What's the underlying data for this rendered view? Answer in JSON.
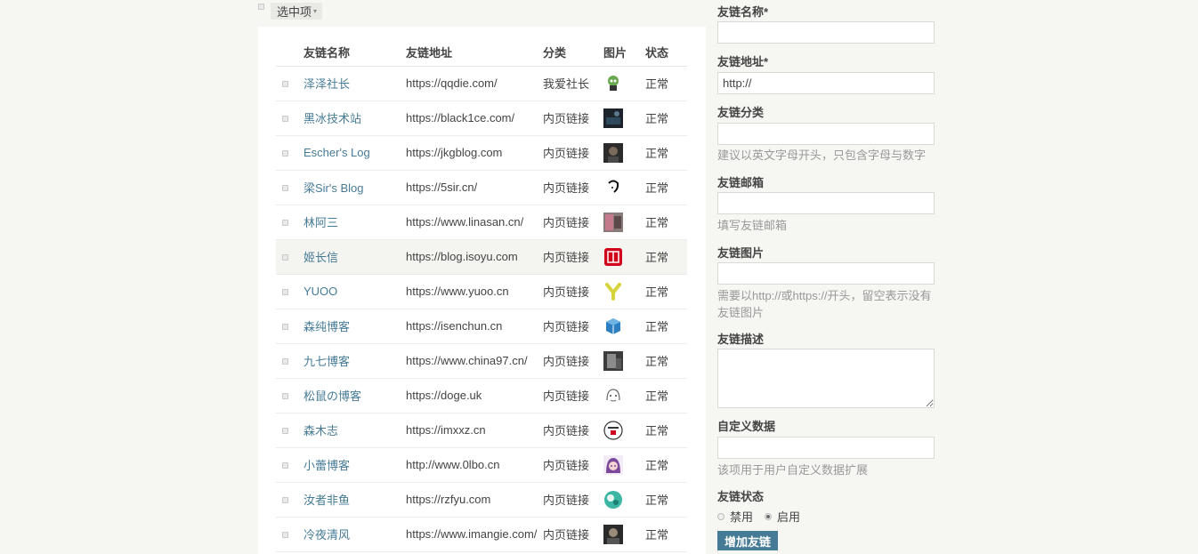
{
  "bulk": {
    "select_label": "选中项",
    "caret": "▾"
  },
  "table": {
    "headers": {
      "name": "友链名称",
      "url": "友链地址",
      "category": "分类",
      "image": "图片",
      "state": "状态"
    },
    "rows": [
      {
        "name": "泽泽社长",
        "url": "https://qqdie.com/",
        "category": "我爱社长",
        "state": "正常",
        "img": "green-robot"
      },
      {
        "name": "黑冰技术站",
        "url": "https://black1ce.com/",
        "category": "内页链接",
        "state": "正常",
        "img": "dark-scene"
      },
      {
        "name": "Escher's Log",
        "url": "https://jkgblog.com",
        "category": "内页链接",
        "state": "正常",
        "img": "dark-portrait"
      },
      {
        "name": "梁Sir's Blog",
        "url": "https://5sir.cn/",
        "category": "内页链接",
        "state": "正常",
        "img": "sketch-face"
      },
      {
        "name": "林阿三",
        "url": "https://www.linasan.cn/",
        "category": "内页链接",
        "state": "正常",
        "img": "photo-collage"
      },
      {
        "name": "姬长信",
        "url": "https://blog.isoyu.com",
        "category": "内页链接",
        "state": "正常",
        "img": "red-seal"
      },
      {
        "name": "YUOO",
        "url": "https://www.yuoo.cn",
        "category": "内页链接",
        "state": "正常",
        "img": "yellow-y"
      },
      {
        "name": "森纯博客",
        "url": "https://isenchun.cn",
        "category": "内页链接",
        "state": "正常",
        "img": "blue-cube"
      },
      {
        "name": "九七博客",
        "url": "https://www.china97.cn/",
        "category": "内页链接",
        "state": "正常",
        "img": "gray-photo"
      },
      {
        "name": "松鼠の博客",
        "url": "https://doge.uk",
        "category": "内页链接",
        "state": "正常",
        "img": "line-face"
      },
      {
        "name": "森木志",
        "url": "https://imxxz.cn",
        "category": "内页链接",
        "state": "正常",
        "img": "round-badge"
      },
      {
        "name": "小蕾博客",
        "url": "http://www.0lbo.cn",
        "category": "内页链接",
        "state": "正常",
        "img": "anime-girl"
      },
      {
        "name": "汝者非鱼",
        "url": "https://rzfyu.com",
        "category": "内页链接",
        "state": "正常",
        "img": "teal-circle"
      },
      {
        "name": "冷夜清风",
        "url": "https://www.imangie.com/",
        "category": "内页链接",
        "state": "正常",
        "img": "dark-avatar"
      }
    ]
  },
  "form": {
    "name_label": "友链名称*",
    "url_label": "友链地址*",
    "url_value": "http://",
    "category_label": "友链分类",
    "category_hint": "建议以英文字母开头，只包含字母与数字",
    "email_label": "友链邮箱",
    "email_hint": "填写友链邮箱",
    "image_label": "友链图片",
    "image_hint": "需要以http://或https://开头，留空表示没有友链图片",
    "desc_label": "友链描述",
    "custom_label": "自定义数据",
    "custom_hint": "该项用于用户自定义数据扩展",
    "status_label": "友链状态",
    "status_disabled": "禁用",
    "status_enabled": "启用",
    "submit_label": "增加友链"
  }
}
